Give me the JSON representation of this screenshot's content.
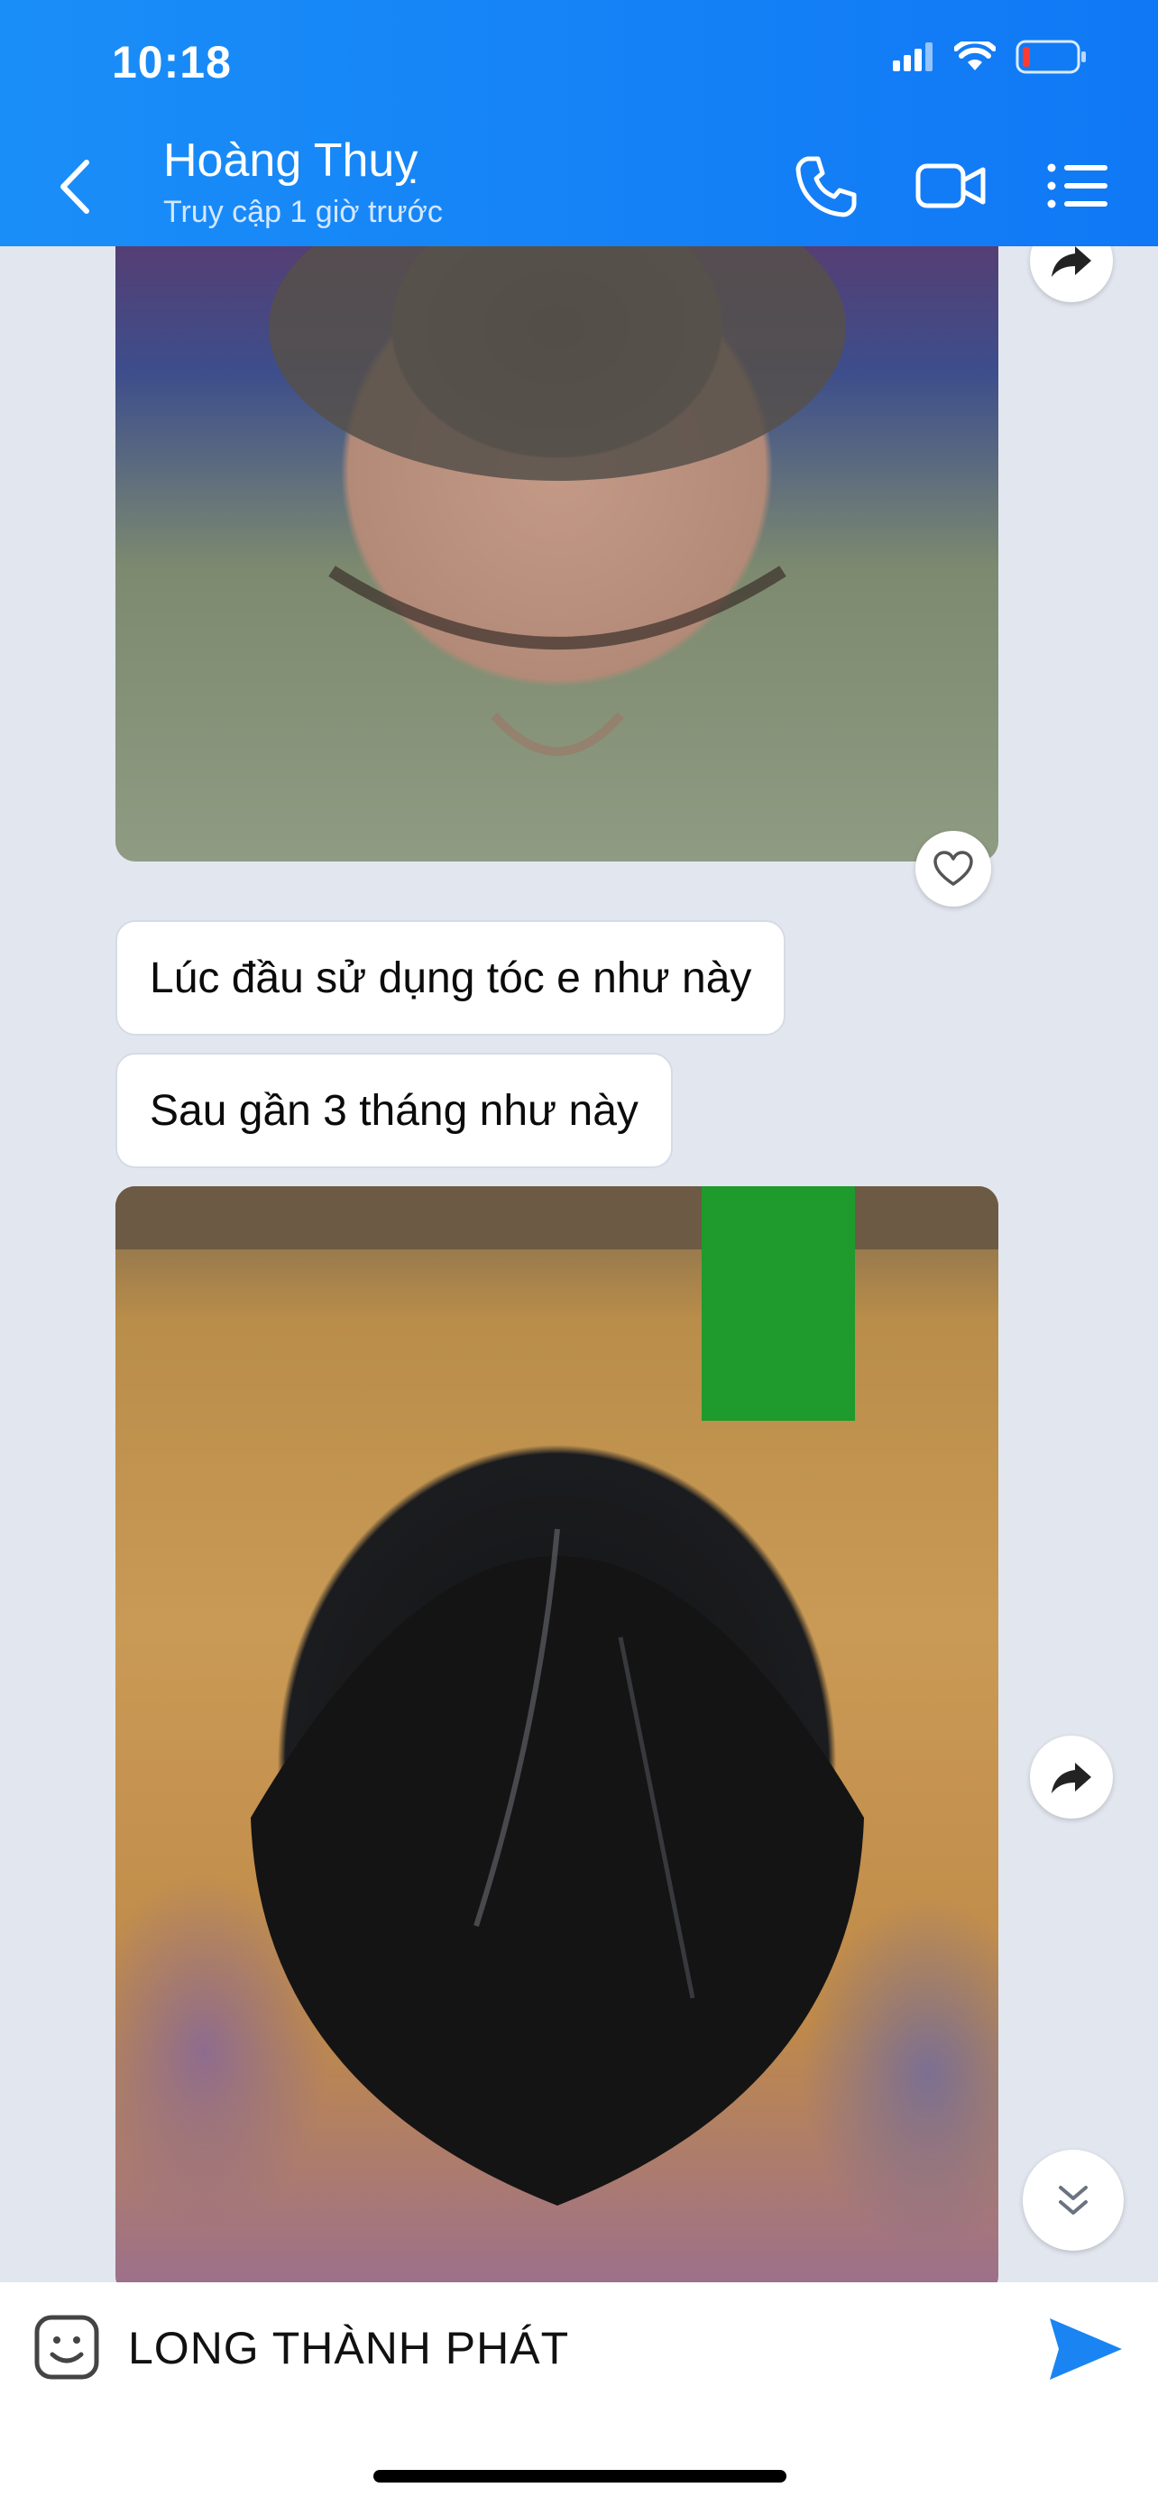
{
  "status_bar": {
    "time": "10:18",
    "icons": [
      "cellular-signal-icon",
      "wifi-icon",
      "battery-low-icon"
    ]
  },
  "header": {
    "contact_name": "Hoàng Thuỵ",
    "contact_status": "Truy cập 1 giờ trước",
    "actions": [
      "phone-call-icon",
      "video-call-icon",
      "menu-list-icon"
    ]
  },
  "messages": [
    {
      "type": "image",
      "alt": "photo-before",
      "actions": [
        "share-icon",
        "heart-icon"
      ]
    },
    {
      "type": "text",
      "text": "Lúc đầu sử dụng tóc e như này"
    },
    {
      "type": "text",
      "text": "Sau gần 3 tháng như này"
    },
    {
      "type": "image",
      "alt": "photo-after",
      "actions": [
        "share-icon"
      ]
    }
  ],
  "composer": {
    "text": "LONG THÀNH PHÁT"
  },
  "colors": {
    "header_start": "#1a8ef8",
    "header_end": "#1078f5",
    "chat_background": "#e2e6ef",
    "send_button": "#1a84f2"
  }
}
